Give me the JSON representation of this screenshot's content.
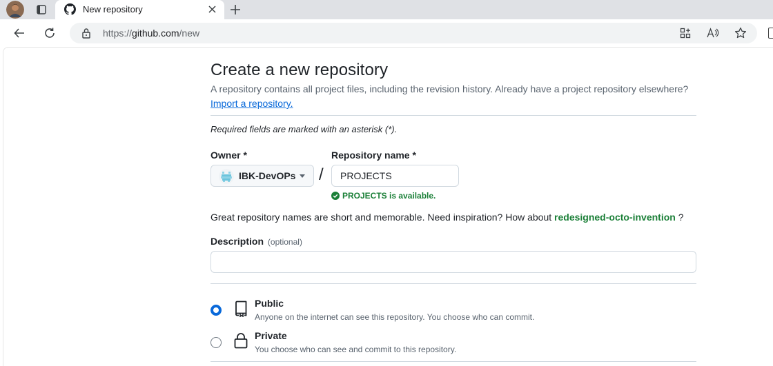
{
  "browser": {
    "tab_title": "New repository",
    "url_scheme": "https://",
    "url_host": "github.com",
    "url_path": "/new"
  },
  "page": {
    "title": "Create a new repository",
    "subtitle": "A repository contains all project files, including the revision history. Already have a project repository elsewhere?",
    "import_link": "Import a repository.",
    "required_note": "Required fields are marked with an asterisk (*).",
    "owner_label": "Owner *",
    "owner_value": "IBK-DevOPs",
    "slash": "/",
    "repo_name_label": "Repository name *",
    "repo_name_value": "PROJECTS",
    "availability": "PROJECTS is available.",
    "hint_text": "Great repository names are short and memorable. Need inspiration? How about",
    "suggestion": "redesigned-octo-invention",
    "hint_suffix": "?",
    "description_label": "Description",
    "description_optional": "(optional)",
    "description_value": "",
    "visibility": [
      {
        "label": "Public",
        "desc": "Anyone on the internet can see this repository. You choose who can commit.",
        "selected": true,
        "icon": "repo-icon"
      },
      {
        "label": "Private",
        "desc": "You choose who can see and commit to this repository.",
        "selected": false,
        "icon": "lock-icon"
      }
    ]
  },
  "colors": {
    "accent": "#0969da",
    "success": "#1a7f37",
    "muted": "#59636e",
    "border": "#d1d9e0"
  }
}
